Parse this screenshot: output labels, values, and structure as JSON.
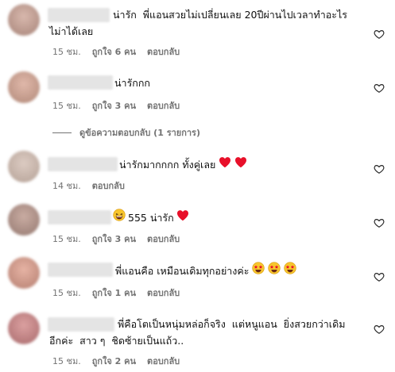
{
  "comments": [
    {
      "text": "น่ารัก  พี่แอนสวยไม่เปลี่ยนเลย 20ปีผ่านไปเวลาทำอะไร\nไม่าได้เลย",
      "time": "15 ชม.",
      "likes": "ถูกใจ 6 คน",
      "reply": "ตอบกลับ",
      "avatar_color": "#c9a99f"
    },
    {
      "text": "น่ารักกก",
      "time": "15 ชม.",
      "likes": "ถูกใจ 3 คน",
      "reply": "ตอบกลับ",
      "avatar_color": "#d1a99a"
    },
    {
      "text": "น่ารักมากกกก  ทั้งคู่เลย",
      "time": "14 ชม.",
      "reply": "ตอบกลับ",
      "avatar_color": "#cbb8ae"
    },
    {
      "text": "555 น่ารัก",
      "time": "15 ชม.",
      "likes": "ถูกใจ 3 คน",
      "reply": "ตอบกลับ",
      "avatar_color": "#b89a90"
    },
    {
      "text": "พี่แอนคือ  เหมือนเดิมทุกอย่างค่ะ",
      "time": "15 ชม.",
      "likes": "ถูกใจ 1 คน",
      "reply": "ตอบกลับ",
      "avatar_color": "#d8a294"
    },
    {
      "text": "พี่คือโตเป็นหนุ่มหล่อก็จริง  แต่หนูแอน  ยิ่งสวยกว่าเดิม\nอีกค่ะ  สาว ๆ  ชิดซ้ายเป็นแถ้ว..",
      "time": "15 ชม.",
      "likes": "ถูกใจ 2 คน",
      "reply": "ตอบกลับ",
      "avatar_color": "#c98f90"
    }
  ],
  "view_replies": "ดูข้อความตอบกลับ (1 รายการ)",
  "colors": {
    "heart_red": "#e8102a",
    "muted": "#737373"
  }
}
